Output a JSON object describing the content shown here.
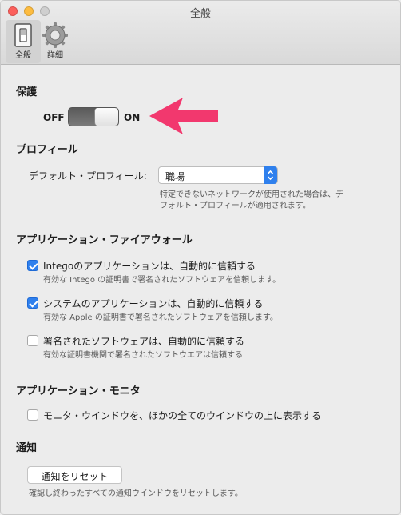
{
  "window": {
    "title": "全般"
  },
  "toolbar": {
    "general_label": "全般",
    "detail_label": "詳細"
  },
  "protection": {
    "title": "保護",
    "off_label": "OFF",
    "on_label": "ON",
    "state": "ON"
  },
  "profile": {
    "title": "プロフィール",
    "default_label": "デフォルト・プロフィール:",
    "selected": "職場",
    "hint_line1": "特定できないネットワークが使用された場合は、デ",
    "hint_line2": "フォルト・プロフィールが適用されます。"
  },
  "firewall": {
    "title": "アプリケーション・ファイアウォール",
    "items": [
      {
        "label": "Integoのアプリケーションは、自動的に信頼する",
        "hint": "有効な Intego の証明書で署名されたソフトウェアを信頼します。",
        "checked": true
      },
      {
        "label": "システムのアプリケーションは、自動的に信頼する",
        "hint": "有効な Apple の証明書で署名されたソフトウェアを信頼します。",
        "checked": true
      },
      {
        "label": "署名されたソフトウェアは、自動的に信頼する",
        "hint": "有効な証明書機関で署名されたソフトウエアは信頼する",
        "checked": false
      }
    ]
  },
  "monitor": {
    "title": "アプリケーション・モニタ",
    "item": {
      "label": "モニタ・ウインドウを、ほかの全てのウインドウの上に表示する",
      "checked": false
    }
  },
  "notify": {
    "title": "通知",
    "reset_label": "通知をリセット",
    "hint": "確認し終わったすべての通知ウインドウをリセットします。"
  },
  "colors": {
    "accent": "#2f80ed",
    "arrow": "#f2386e",
    "background": "#ececec"
  },
  "icons": {
    "general": "switch-icon",
    "detail": "gear-icon",
    "arrow": "pointer-arrow-icon",
    "select": "updown-chevron-icon"
  }
}
